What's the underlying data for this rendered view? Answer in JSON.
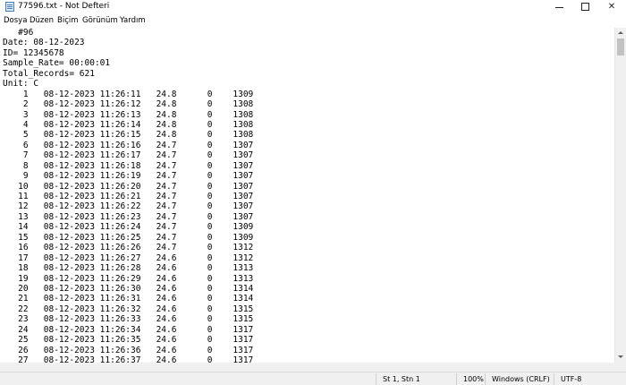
{
  "window": {
    "title": "77596.txt - Not Defteri",
    "controls": {
      "minimize": "minimize",
      "maximize": "maximize",
      "close": "✕"
    }
  },
  "menu": {
    "items": [
      "Dosya",
      "Düzen",
      "Biçim",
      "Görünüm",
      "Yardım"
    ]
  },
  "editor": {
    "lines": [
      "   #96",
      "Date: 08-12-2023",
      "ID= 12345678",
      "Sample_Rate= 00:00:01",
      "Total_Records= 621",
      "Unit: C",
      "    1   08-12-2023 11:26:11   24.8      0    1309",
      "    2   08-12-2023 11:26:12   24.8      0    1308",
      "    3   08-12-2023 11:26:13   24.8      0    1308",
      "    4   08-12-2023 11:26:14   24.8      0    1308",
      "    5   08-12-2023 11:26:15   24.8      0    1308",
      "    6   08-12-2023 11:26:16   24.7      0    1307",
      "    7   08-12-2023 11:26:17   24.7      0    1307",
      "    8   08-12-2023 11:26:18   24.7      0    1307",
      "    9   08-12-2023 11:26:19   24.7      0    1307",
      "   10   08-12-2023 11:26:20   24.7      0    1307",
      "   11   08-12-2023 11:26:21   24.7      0    1307",
      "   12   08-12-2023 11:26:22   24.7      0    1307",
      "   13   08-12-2023 11:26:23   24.7      0    1307",
      "   14   08-12-2023 11:26:24   24.7      0    1309",
      "   15   08-12-2023 11:26:25   24.7      0    1309",
      "   16   08-12-2023 11:26:26   24.7      0    1312",
      "   17   08-12-2023 11:26:27   24.6      0    1312",
      "   18   08-12-2023 11:26:28   24.6      0    1313",
      "   19   08-12-2023 11:26:29   24.6      0    1313",
      "   20   08-12-2023 11:26:30   24.6      0    1314",
      "   21   08-12-2023 11:26:31   24.6      0    1314",
      "   22   08-12-2023 11:26:32   24.6      0    1315",
      "   23   08-12-2023 11:26:33   24.6      0    1315",
      "   24   08-12-2023 11:26:34   24.6      0    1317",
      "   25   08-12-2023 11:26:35   24.6      0    1317",
      "   26   08-12-2023 11:26:36   24.6      0    1317",
      "   27   08-12-2023 11:26:37   24.6      0    1317"
    ]
  },
  "status": {
    "position": "St 1, Stn 1",
    "zoom": "100%",
    "line_ending": "Windows (CRLF)",
    "encoding": "UTF-8"
  }
}
